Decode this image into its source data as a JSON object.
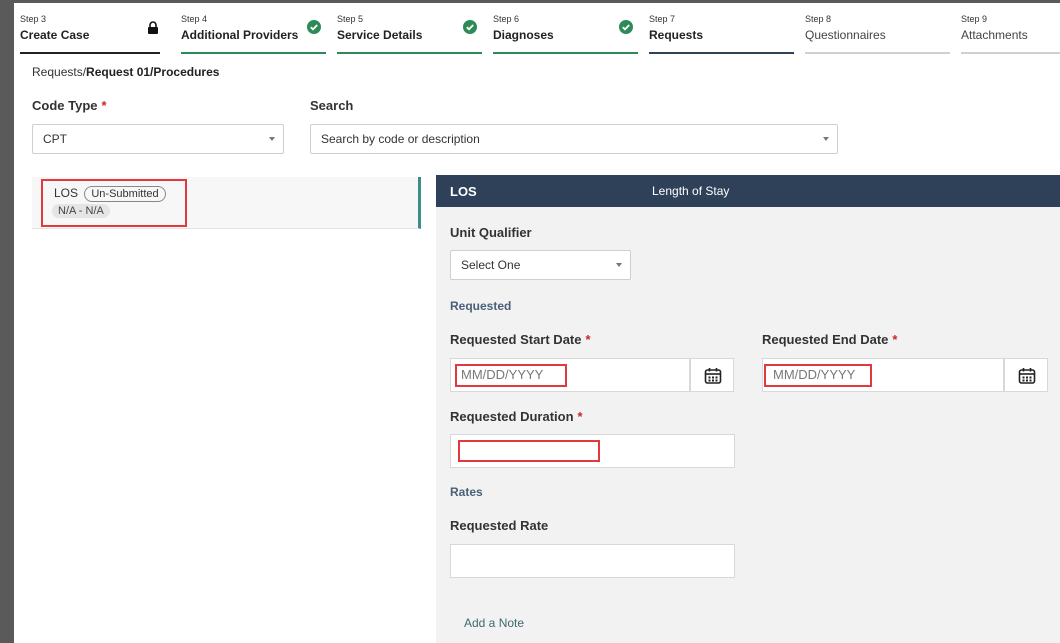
{
  "stepper": [
    {
      "num": "Step 3",
      "title": "Create Case",
      "status": "locked",
      "icon": "lock-icon",
      "bar": "#222222"
    },
    {
      "num": "Step 4",
      "title": "Additional Providers",
      "status": "complete",
      "icon": "check-icon",
      "bar": "#2e8b57"
    },
    {
      "num": "Step 5",
      "title": "Service Details",
      "status": "complete",
      "icon": "check-icon",
      "bar": "#2e8b57"
    },
    {
      "num": "Step 6",
      "title": "Diagnoses",
      "status": "complete",
      "icon": "check-icon",
      "bar": "#2e8b57"
    },
    {
      "num": "Step 7",
      "title": "Requests",
      "status": "current",
      "icon": "",
      "bar": "#2f4059"
    },
    {
      "num": "Step 8",
      "title": "Questionnaires",
      "status": "inactive",
      "icon": "",
      "bar": "#d0d0d0"
    },
    {
      "num": "Step 9",
      "title": "Attachments",
      "status": "inactive",
      "icon": "",
      "bar": "#d0d0d0"
    }
  ],
  "breadcrumb": {
    "prefix": "Requests/",
    "current": "Request 01/Procedures"
  },
  "filters": {
    "code_type_label": "Code Type",
    "code_type_value": "CPT",
    "search_label": "Search",
    "search_placeholder": "Search by code or description"
  },
  "procedure_item": {
    "code": "LOS",
    "status": "Un-Submitted",
    "range": "N/A - N/A"
  },
  "panel": {
    "code": "LOS",
    "description": "Length of Stay",
    "unit_qualifier_label": "Unit Qualifier",
    "unit_qualifier_value": "Select One",
    "requested_section": "Requested",
    "start_date_label": "Requested Start Date",
    "start_date_placeholder": "MM/DD/YYYY",
    "end_date_label": "Requested End Date",
    "end_date_placeholder": "MM/DD/YYYY",
    "duration_label": "Requested Duration",
    "rates_section": "Rates",
    "rate_label": "Requested Rate",
    "add_note": "Add a Note"
  },
  "colors": {
    "accent": "#2f4059",
    "complete": "#2e8b57",
    "highlight": "#e0393e",
    "required": "#c62828"
  }
}
